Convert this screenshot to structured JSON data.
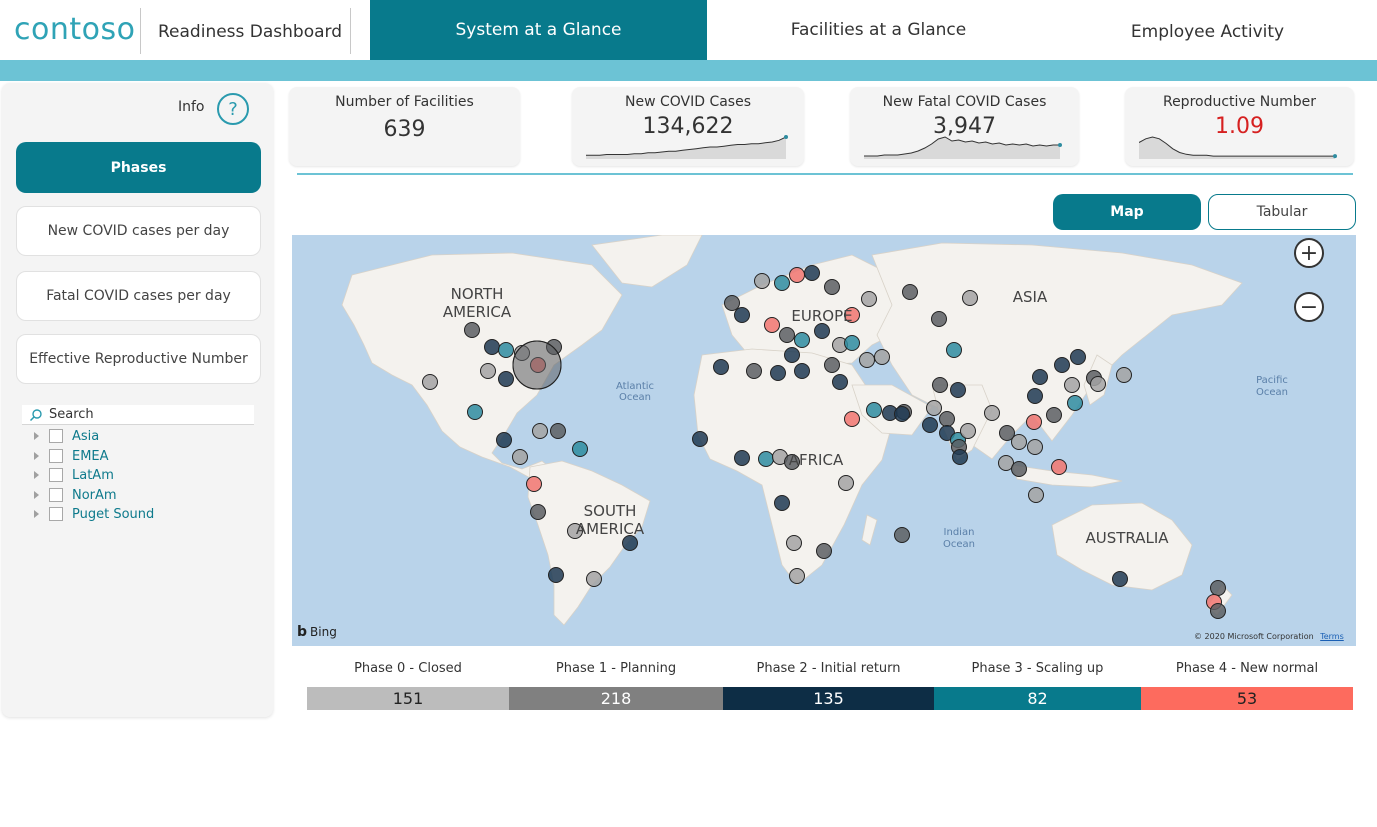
{
  "header": {
    "brand": "contoso",
    "title": "Readiness Dashboard",
    "tabs": [
      {
        "label": "System at a Glance",
        "active": true
      },
      {
        "label": "Facilities at a Glance",
        "active": false
      },
      {
        "label": "Employee Activity",
        "active": false
      }
    ]
  },
  "sidebar": {
    "info_label": "Info",
    "info_icon": "?",
    "buttons": [
      {
        "label": "Phases",
        "active": true
      },
      {
        "label": "New COVID cases per day",
        "active": false
      },
      {
        "label": "Fatal COVID cases per day",
        "active": false
      },
      {
        "label": "Effective Reproductive Number",
        "active": false
      }
    ],
    "search_placeholder": "Search",
    "regions": [
      "Asia",
      "EMEA",
      "LatAm",
      "NorAm",
      "Puget Sound"
    ]
  },
  "kpis": [
    {
      "title": "Number of Facilities",
      "value": "639"
    },
    {
      "title": "New COVID Cases",
      "value": "134,622",
      "sparkline": [
        2,
        2,
        2,
        3,
        3,
        3,
        3,
        4,
        4,
        5,
        5,
        6,
        7,
        7,
        8,
        9,
        10,
        11,
        12,
        12,
        13,
        14,
        15,
        15,
        16,
        16,
        17,
        18,
        20,
        24
      ]
    },
    {
      "title": "New Fatal COVID Cases",
      "value": "3,947",
      "sparkline": [
        1,
        1,
        1,
        2,
        2,
        2,
        3,
        4,
        6,
        9,
        13,
        18,
        20,
        16,
        17,
        15,
        16,
        14,
        15,
        13,
        14,
        12,
        13,
        12,
        13,
        11,
        12,
        11,
        12,
        12
      ]
    },
    {
      "title": "Reproductive Number",
      "value": "1.09",
      "value_color": "#d62020",
      "sparkline": [
        16,
        20,
        22,
        20,
        15,
        9,
        5,
        3,
        2,
        2,
        2,
        1,
        1,
        1,
        1,
        1,
        1,
        1,
        1,
        1,
        1,
        1,
        1,
        1,
        1,
        1,
        1,
        1,
        1,
        1
      ]
    }
  ],
  "view_toggle": {
    "map_label": "Map",
    "tabular_label": "Tabular",
    "selected": "Map"
  },
  "map": {
    "labels": {
      "north_america": [
        "NORTH",
        "AMERICA"
      ],
      "south_america": [
        "SOUTH",
        "AMERICA"
      ],
      "europe": "EUROPE",
      "asia": "ASIA",
      "africa": "AFRICA",
      "australia": "AUSTRALIA",
      "atlantic": [
        "Atlantic",
        "Ocean"
      ],
      "pacific": [
        "Pacific",
        "Ocean"
      ],
      "indian": [
        "Indian",
        "Ocean"
      ]
    },
    "attribution": "© 2020 Microsoft Corporation",
    "terms": "Terms",
    "provider": "Bing",
    "zoom_in": "+",
    "zoom_out": "−"
  },
  "phases": [
    {
      "label": "Phase 0 - Closed",
      "count": "151",
      "color": "#bcbcbc",
      "text_color": "#222"
    },
    {
      "label": "Phase 1 - Planning",
      "count": "218",
      "color": "#808080",
      "text_color": "#fff"
    },
    {
      "label": "Phase 2 - Initial return",
      "count": "135",
      "color": "#0d2d45",
      "text_color": "#fff"
    },
    {
      "label": "Phase 3 - Scaling up",
      "count": "82",
      "color": "#087a8c",
      "text_color": "#fff"
    },
    {
      "label": "Phase 4 - New normal",
      "count": "53",
      "color": "#fd6b5e",
      "text_color": "#222"
    }
  ],
  "marker_colors": {
    "gray": "#a3a3a3",
    "dark": "#5c5f63",
    "navy": "#1f3a52",
    "teal": "#2e8ca0",
    "red": "#f17670"
  }
}
